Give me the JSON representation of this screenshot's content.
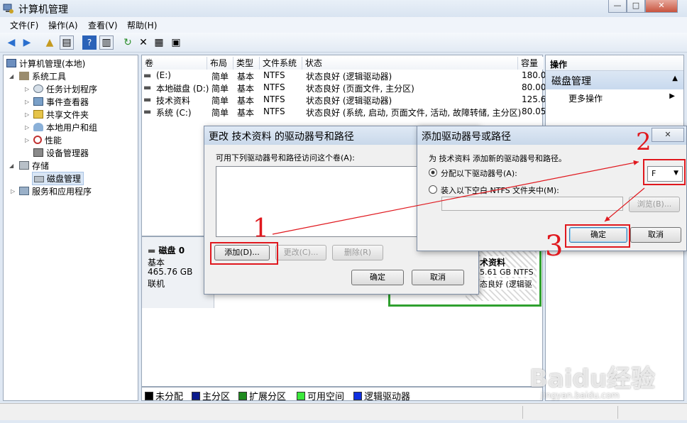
{
  "window": {
    "title": "计算机管理",
    "min": "—",
    "max": "□",
    "close": "✕"
  },
  "menu": [
    "文件(F)",
    "操作(A)",
    "查看(V)",
    "帮助(H)"
  ],
  "tree": {
    "root": "计算机管理(本地)",
    "system_tools": "系统工具",
    "task_scheduler": "任务计划程序",
    "event_viewer": "事件查看器",
    "shared_folders": "共享文件夹",
    "local_users": "本地用户和组",
    "performance": "性能",
    "device_manager": "设备管理器",
    "storage": "存储",
    "disk_management": "磁盘管理",
    "services_apps": "服务和应用程序"
  },
  "list": {
    "headers": [
      "卷",
      "布局",
      "类型",
      "文件系统",
      "状态",
      "容量"
    ],
    "rows": [
      [
        "(E:)",
        "简单",
        "基本",
        "NTFS",
        "状态良好 (逻辑驱动器)",
        "180.0"
      ],
      [
        "本地磁盘 (D:)",
        "简单",
        "基本",
        "NTFS",
        "状态良好 (页面文件, 主分区)",
        "80.00"
      ],
      [
        "技术资料",
        "简单",
        "基本",
        "NTFS",
        "状态良好 (逻辑驱动器)",
        "125.6"
      ],
      [
        "系统 (C:)",
        "简单",
        "基本",
        "NTFS",
        "状态良好 (系统, 启动, 页面文件, 活动, 故障转储, 主分区)",
        "80.05"
      ]
    ]
  },
  "disk": {
    "name": "磁盘 0",
    "type": "基本",
    "size": "465.76 GB",
    "status": "联机",
    "partition_label": "术资料",
    "partition_size": "5.61 GB NTFS",
    "partition_status": "态良好 (逻辑驱"
  },
  "legend": [
    {
      "label": "未分配",
      "color": "#000000"
    },
    {
      "label": "主分区",
      "color": "#0a1a8c"
    },
    {
      "label": "扩展分区",
      "color": "#1f8a1f"
    },
    {
      "label": "可用空间",
      "color": "#3ce83c"
    },
    {
      "label": "逻辑驱动器",
      "color": "#1030e0"
    }
  ],
  "actions": {
    "header": "操作",
    "section": "磁盘管理",
    "more": "更多操作"
  },
  "dialog1": {
    "title": "更改 技术资料 的驱动器号和路径",
    "label": "可用下列驱动器号和路径访问这个卷(A):",
    "add": "添加(D)...",
    "change": "更改(C)...",
    "delete": "删除(R)",
    "ok": "确定",
    "cancel": "取消"
  },
  "dialog2": {
    "title": "添加驱动器号或路径",
    "prompt": "为 技术资料 添加新的驱动器号和路径。",
    "assign": "分配以下驱动器号(A):",
    "mount": "装入以下空白 NTFS 文件夹中(M):",
    "drive_letter": "F",
    "browse": "浏览(B)...",
    "ok": "确定",
    "cancel": "取消",
    "close": "✕"
  },
  "annotations": {
    "n1": "1",
    "n2": "2",
    "n3": "3"
  },
  "watermark": {
    "brand": "Baidu经验",
    "url": "jingyan.baidu.com"
  }
}
